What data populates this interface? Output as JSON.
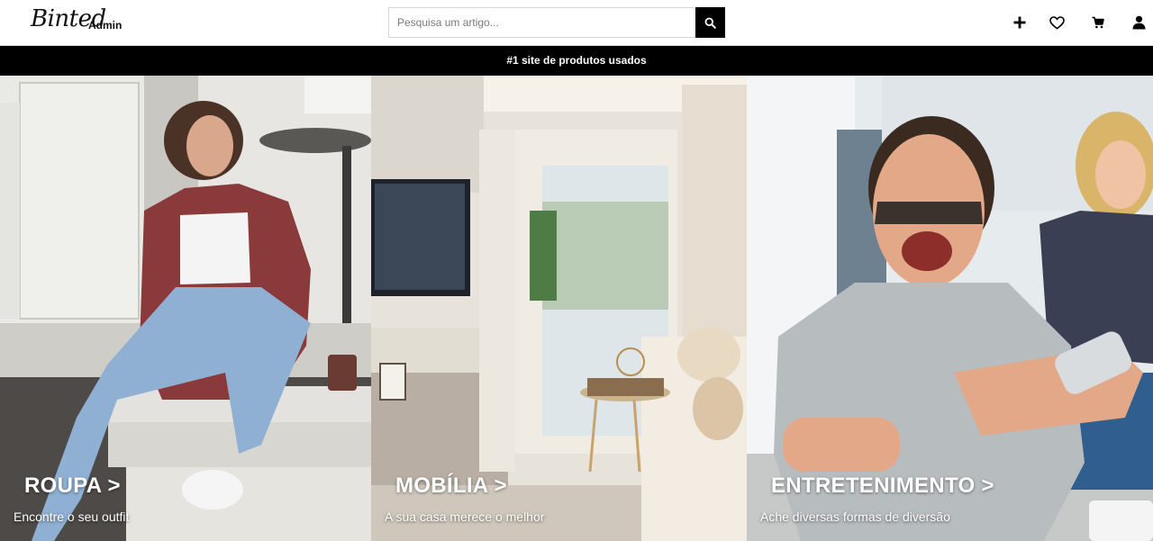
{
  "header": {
    "logo": "Binted",
    "admin_label": "Admin",
    "search": {
      "placeholder": "Pesquisa um artigo...",
      "value": ""
    },
    "icons": [
      "search-icon",
      "plus-icon",
      "heart-icon",
      "cart-icon",
      "user-icon"
    ]
  },
  "banner": {
    "text": "#1 site de produtos usados"
  },
  "categories": [
    {
      "title": "ROUPA >",
      "subtitle": "Encontre o seu outfit"
    },
    {
      "title": "MOBÍLIA >",
      "subtitle": "A sua casa merece o melhor"
    },
    {
      "title": "ENTRETENIMENTO >",
      "subtitle": "Ache diversas formas de diversão"
    }
  ],
  "colors": {
    "accent": "#000000",
    "text_light": "#ffffff"
  }
}
